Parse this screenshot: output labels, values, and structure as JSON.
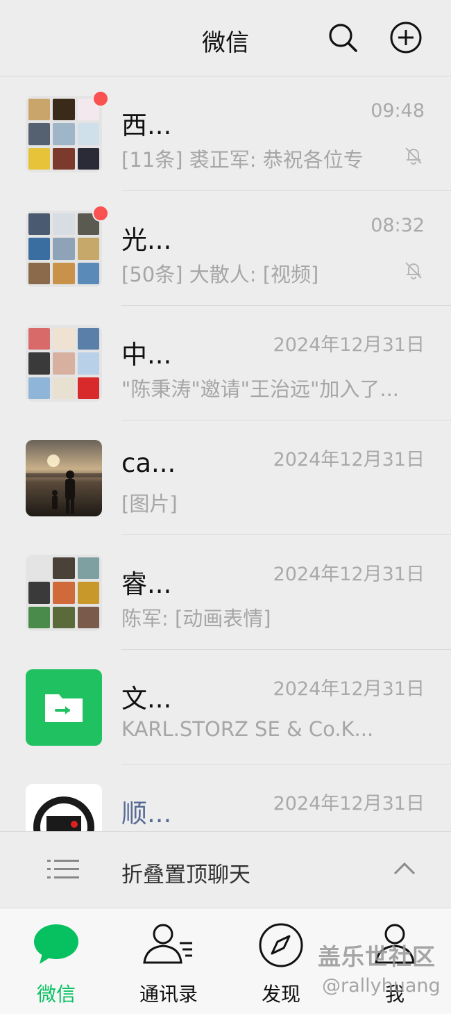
{
  "header": {
    "title": "微信",
    "search_icon": "search-icon",
    "add_icon": "plus-circle-icon"
  },
  "chats": [
    {
      "name": "西...",
      "time": "09:48",
      "preview": "[11条] 裘正军: 恭祝各位专",
      "muted": true,
      "unread_dot": true,
      "avatar": "group-grid"
    },
    {
      "name": "光...",
      "time": "08:32",
      "preview": "[50条] 大散人: [视频]",
      "muted": true,
      "unread_dot": true,
      "avatar": "group-grid"
    },
    {
      "name": "中...",
      "time": "2024年12月31日",
      "preview": "\"陈秉涛\"邀请\"王治远\"加入了...",
      "muted": false,
      "unread_dot": false,
      "avatar": "group-grid"
    },
    {
      "name": "ca...",
      "time": "2024年12月31日",
      "preview": "[图片]",
      "muted": false,
      "unread_dot": false,
      "avatar": "sunset-photo"
    },
    {
      "name": "睿...",
      "time": "2024年12月31日",
      "preview": "陈军: [动画表情]",
      "muted": false,
      "unread_dot": false,
      "avatar": "group-grid"
    },
    {
      "name": "文...",
      "time": "2024年12月31日",
      "preview": "KARL.STORZ SE & Co.K...",
      "muted": false,
      "unread_dot": false,
      "avatar": "file-transfer"
    },
    {
      "name": "顺...",
      "time": "2024年12月31日",
      "preview": "",
      "muted": false,
      "unread_dot": false,
      "avatar": "sf-logo"
    }
  ],
  "fold": {
    "label": "折叠置顶聊天",
    "icon": "list-icon",
    "chevron": "chevron-up-icon"
  },
  "tabs": [
    {
      "label": "微信",
      "icon": "chat-bubble-icon",
      "active": true
    },
    {
      "label": "通讯录",
      "icon": "contacts-icon",
      "active": false
    },
    {
      "label": "发现",
      "icon": "compass-icon",
      "active": false
    },
    {
      "label": "我",
      "icon": "person-icon",
      "active": false
    }
  ],
  "watermark": {
    "line1": "盖乐世社区",
    "line2": "@rallyhuang"
  },
  "colors": {
    "accent": "#07c160",
    "unread": "#fa5151",
    "link_name": "#576b95"
  }
}
